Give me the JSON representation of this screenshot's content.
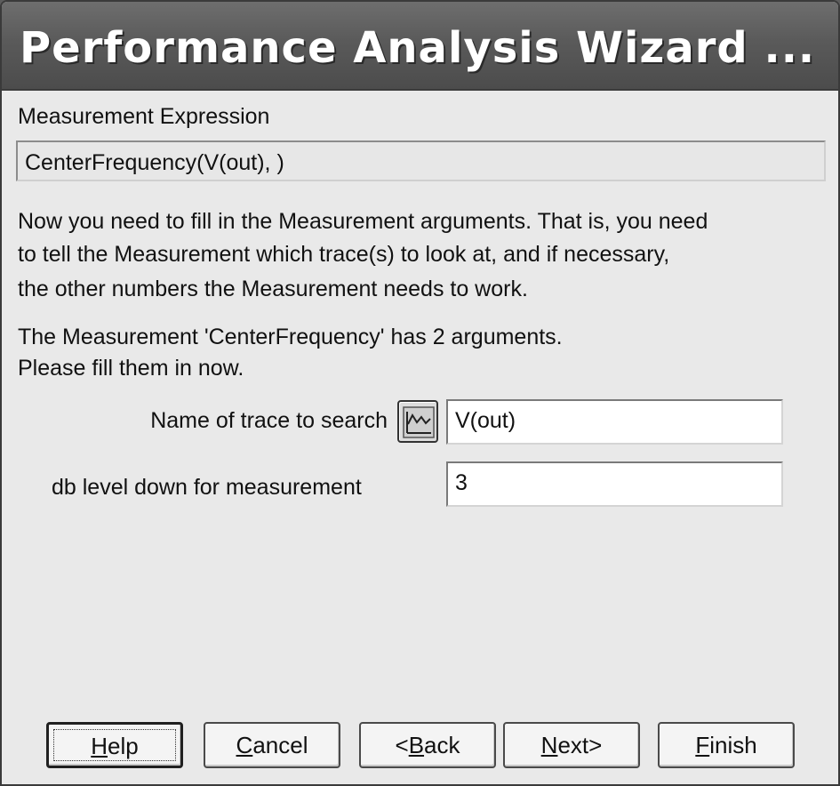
{
  "window": {
    "title": "Performance Analysis Wizard ..."
  },
  "expression": {
    "label": "Measurement Expression",
    "value": "CenterFrequency(V(out), )"
  },
  "instructions": {
    "line1": "Now you need to fill in the Measurement arguments.  That is, you need",
    "line2": "to tell the Measurement which trace(s) to look at, and if necessary,",
    "line3": "the other numbers the Measurement needs to work."
  },
  "argument_info": {
    "line1": "The Measurement 'CenterFrequency' has 2 arguments.",
    "line2": "Please fill them in now."
  },
  "arguments": [
    {
      "label": "Name of trace to search",
      "value": "V(out)",
      "icon": "trace-browse-icon"
    },
    {
      "label": "db level down for measurement",
      "value": "3"
    }
  ],
  "buttons": {
    "help": {
      "accel": "H",
      "rest": "elp"
    },
    "cancel": {
      "accel": "C",
      "rest": "ancel"
    },
    "back": {
      "pre": "<",
      "accel": "B",
      "rest": "ack"
    },
    "next": {
      "accel": "N",
      "rest": "ext>"
    },
    "finish": {
      "accel": "F",
      "rest": "inish"
    }
  }
}
